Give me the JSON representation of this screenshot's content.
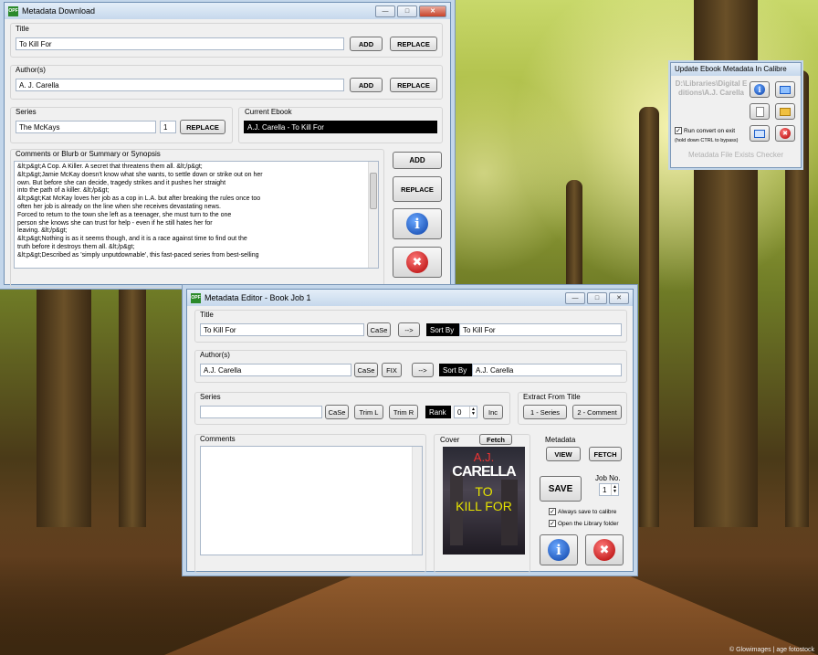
{
  "download_window": {
    "title": "Metadata Download",
    "title_label": "Title",
    "title_value": "To Kill For",
    "add_label": "ADD",
    "replace_label": "REPLACE",
    "author_label": "Author(s)",
    "author_value": "A. J. Carella",
    "series_label": "Series",
    "series_value": "The McKays",
    "series_index": "1",
    "current_ebook_label": "Current Ebook",
    "current_ebook_value": "A.J. Carella - To Kill For",
    "comments_label": "Comments or Blurb or Summary or Synopsis",
    "comments_lines": [
      "&lt;p&gt;A Cop. A Killer. A secret that threatens them all.  &lt;/p&gt;",
      "&lt;p&gt;Jamie McKay doesn't know what she wants, to settle down or strike out on her",
      "own. But before she can decide, tragedy strikes and it pushes her straight",
      "into the path of a killer.  &lt;/p&gt;",
      "&lt;p&gt;Kat McKay loves her job as a cop in L.A. but after breaking the rules once too",
      "often her job is already on the line when she receives devastating news.",
      "Forced to return to the town she left as a teenager, she must turn to the one",
      "person she knows she can trust for help - even if he still hates her for",
      "leaving.  &lt;/p&gt;",
      "&lt;p&gt;Nothing is as it seems though, and it is a race against time to find out the",
      "truth before it destroys them all.  &lt;/p&gt;",
      "&lt;p&gt;Described as 'simply unputdownable', this fast-paced series from best-selling"
    ],
    "side_add_label": "ADD",
    "side_replace_label": "REPLACE"
  },
  "update_panel": {
    "title": "Update Ebook Metadata In Calibre",
    "path": "D:\\Libraries\\Digital Editions\\A.J. Carella",
    "run_convert_label": "Run convert on exit",
    "run_convert_note": "(hold down CTRL to bypass)",
    "checker_label": "Metadata File Exists Checker"
  },
  "editor_window": {
    "title": "Metadata Editor - Book Job 1",
    "title_label": "Title",
    "title_value": "To Kill For",
    "case_label": "CaSe",
    "arrow_label": "-->",
    "sort_by_label": "Sort By",
    "title_sort_value": "To Kill For",
    "author_label": "Author(s)",
    "author_value": "A.J. Carella",
    "fix_label": "FIX",
    "author_sort_value": "A.J. Carella",
    "series_label": "Series",
    "series_value": "",
    "trim_l_label": "Trim L",
    "trim_r_label": "Trim R",
    "rank_label": "Rank",
    "rank_value": "0",
    "inc_label": "Inc",
    "extract_label": "Extract From Title",
    "one_series_label": "1 - Series",
    "two_comment_label": "2 - Comment",
    "comments_label": "Comments",
    "cover_label": "Cover",
    "fetch_label": "Fetch",
    "metadata_label": "Metadata",
    "view_label": "VIEW",
    "fetch_meta_label": "FETCH",
    "save_label": "SAVE",
    "job_no_label": "Job No.",
    "job_no_value": "1",
    "always_save_label": "Always save to calibre",
    "open_library_label": "Open the Library folder",
    "cover": {
      "author_line1": "A.J.",
      "author_line2": "CARELLA",
      "title_line1": "TO",
      "title_line2": "KILL FOR"
    }
  },
  "credit": "© Glowimages | age fotostock"
}
